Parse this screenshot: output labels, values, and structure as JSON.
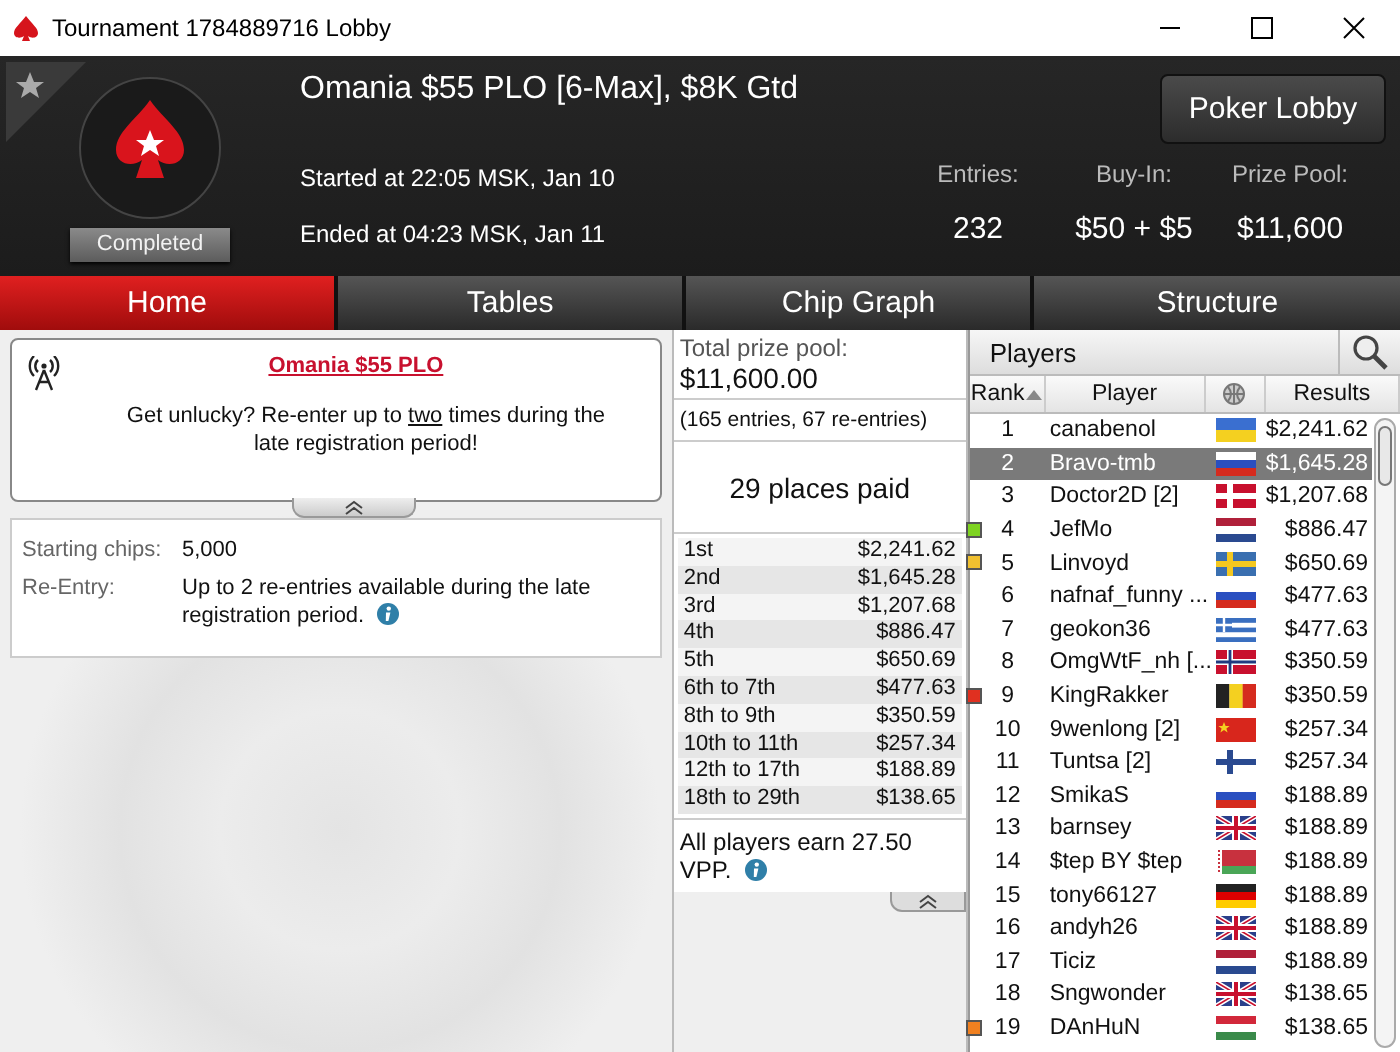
{
  "window": {
    "title": "Tournament 1784889716 Lobby"
  },
  "header": {
    "tournament_name": "Omania $55 PLO [6-Max], $8K Gtd",
    "status": "Completed",
    "started": "Started at 22:05 MSK, Jan 10",
    "ended": "Ended at 04:23 MSK, Jan 11",
    "button": "Poker Lobby",
    "stats": [
      {
        "label": "Entries:",
        "value": "232"
      },
      {
        "label": "Buy-In:",
        "value": "$50 + $5"
      },
      {
        "label": "Prize Pool:",
        "value": "$11,600"
      }
    ]
  },
  "tabs": [
    {
      "label": "Home",
      "selected": true
    },
    {
      "label": "Tables",
      "selected": false
    },
    {
      "label": "Chip Graph",
      "selected": false
    },
    {
      "label": "Structure",
      "selected": false
    }
  ],
  "home": {
    "news": {
      "title": "Omania $55 PLO",
      "text_before": "Get unlucky? Re-enter up to ",
      "underlined": "two",
      "text_after": " times during the late registration period!"
    },
    "details": [
      {
        "label": "Starting chips:",
        "value": "5,000",
        "info": false
      },
      {
        "label": "Re-Entry:",
        "value": "Up to 2 re-entries available during the late registration period.",
        "info": true
      }
    ]
  },
  "prizes": {
    "total_label": "Total prize pool:",
    "total": "$11,600.00",
    "entries_note": "(165 entries, 67 re-entries)",
    "places_paid": "29 places paid",
    "rows": [
      {
        "place": "1st",
        "amount": "$2,241.62"
      },
      {
        "place": "2nd",
        "amount": "$1,645.28"
      },
      {
        "place": "3rd",
        "amount": "$1,207.68"
      },
      {
        "place": "4th",
        "amount": "$886.47"
      },
      {
        "place": "5th",
        "amount": "$650.69"
      },
      {
        "place": "6th to 7th",
        "amount": "$477.63"
      },
      {
        "place": "8th to 9th",
        "amount": "$350.59"
      },
      {
        "place": "10th to 11th",
        "amount": "$257.34"
      },
      {
        "place": "12th to 17th",
        "amount": "$188.89"
      },
      {
        "place": "18th to 29th",
        "amount": "$138.65"
      }
    ],
    "vpp_note": "All players earn 27.50 VPP."
  },
  "players": {
    "title": "Players",
    "columns": [
      "Rank",
      "Player",
      "Results"
    ],
    "rows": [
      {
        "rank": "1",
        "name": "canabenol",
        "result": "$2,241.62",
        "selected": false
      },
      {
        "rank": "2",
        "name": "Bravo-tmb",
        "result": "$1,645.28",
        "selected": true
      },
      {
        "rank": "3",
        "name": "Doctor2D [2]",
        "result": "$1,207.68",
        "selected": false
      },
      {
        "rank": "4",
        "name": "JefMo",
        "result": "$886.47",
        "selected": false,
        "color": "#7ed321"
      },
      {
        "rank": "5",
        "name": "Linvoyd",
        "result": "$650.69",
        "selected": false,
        "color": "#f0c030"
      },
      {
        "rank": "6",
        "name": "nafnaf_funny ...",
        "result": "$477.63",
        "selected": false
      },
      {
        "rank": "7",
        "name": "geokon36",
        "result": "$477.63",
        "selected": false
      },
      {
        "rank": "8",
        "name": "OmgWtF_nh [...",
        "result": "$350.59",
        "selected": false
      },
      {
        "rank": "9",
        "name": "KingRakker",
        "result": "$350.59",
        "selected": false,
        "color": "#e03020"
      },
      {
        "rank": "10",
        "name": "9wenlong [2]",
        "result": "$257.34",
        "selected": false
      },
      {
        "rank": "11",
        "name": "Tuntsa [2]",
        "result": "$257.34",
        "selected": false
      },
      {
        "rank": "12",
        "name": "SmikaS",
        "result": "$188.89",
        "selected": false
      },
      {
        "rank": "13",
        "name": "barnsey",
        "result": "$188.89",
        "selected": false
      },
      {
        "rank": "14",
        "name": "$tep BY $tep",
        "result": "$188.89",
        "selected": false
      },
      {
        "rank": "15",
        "name": "tony66127",
        "result": "$188.89",
        "selected": false
      },
      {
        "rank": "16",
        "name": "andyh26",
        "result": "$188.89",
        "selected": false
      },
      {
        "rank": "17",
        "name": "Ticiz",
        "result": "$188.89",
        "selected": false
      },
      {
        "rank": "18",
        "name": "Sngwonder",
        "result": "$138.65",
        "selected": false
      },
      {
        "rank": "19",
        "name": "DAnHuN",
        "result": "$138.65",
        "selected": false,
        "color": "#f08020"
      }
    ]
  }
}
